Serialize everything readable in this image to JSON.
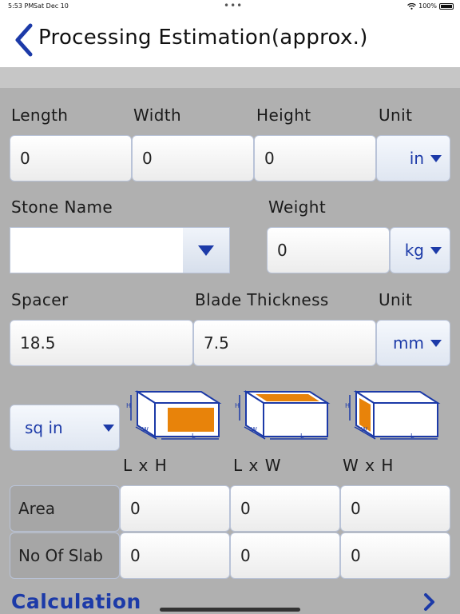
{
  "status_bar": {
    "time": "5:53 PM",
    "date": "Sat Dec 10",
    "battery": "100%"
  },
  "nav": {
    "title": "Processing Estimation(approx.)"
  },
  "dimensions": {
    "length_label": "Length",
    "width_label": "Width",
    "height_label": "Height",
    "unit_label": "Unit",
    "length_value": "0",
    "width_value": "0",
    "height_value": "0",
    "unit_value": "in"
  },
  "stone": {
    "name_label": "Stone Name",
    "name_value": "",
    "weight_label": "Weight",
    "weight_value": "0",
    "weight_unit": "kg"
  },
  "cutting": {
    "spacer_label": "Spacer",
    "blade_label": "Blade Thickness",
    "unit_label": "Unit",
    "spacer_value": "18.5",
    "blade_value": "7.5",
    "unit_value": "mm"
  },
  "area_unit": "sq in",
  "columns": [
    "L x H",
    "L x W",
    "W x H"
  ],
  "rows": [
    {
      "label": "Area",
      "values": [
        "0",
        "0",
        "0"
      ]
    },
    {
      "label": "No Of Slab",
      "values": [
        "0",
        "0",
        "0"
      ]
    }
  ],
  "cube_letters": {
    "h": "H",
    "w": "W",
    "l": "L"
  },
  "calculation_label": "Calculation",
  "colors": {
    "accent": "#1c3aa8",
    "face_fill": "#e8830a"
  }
}
